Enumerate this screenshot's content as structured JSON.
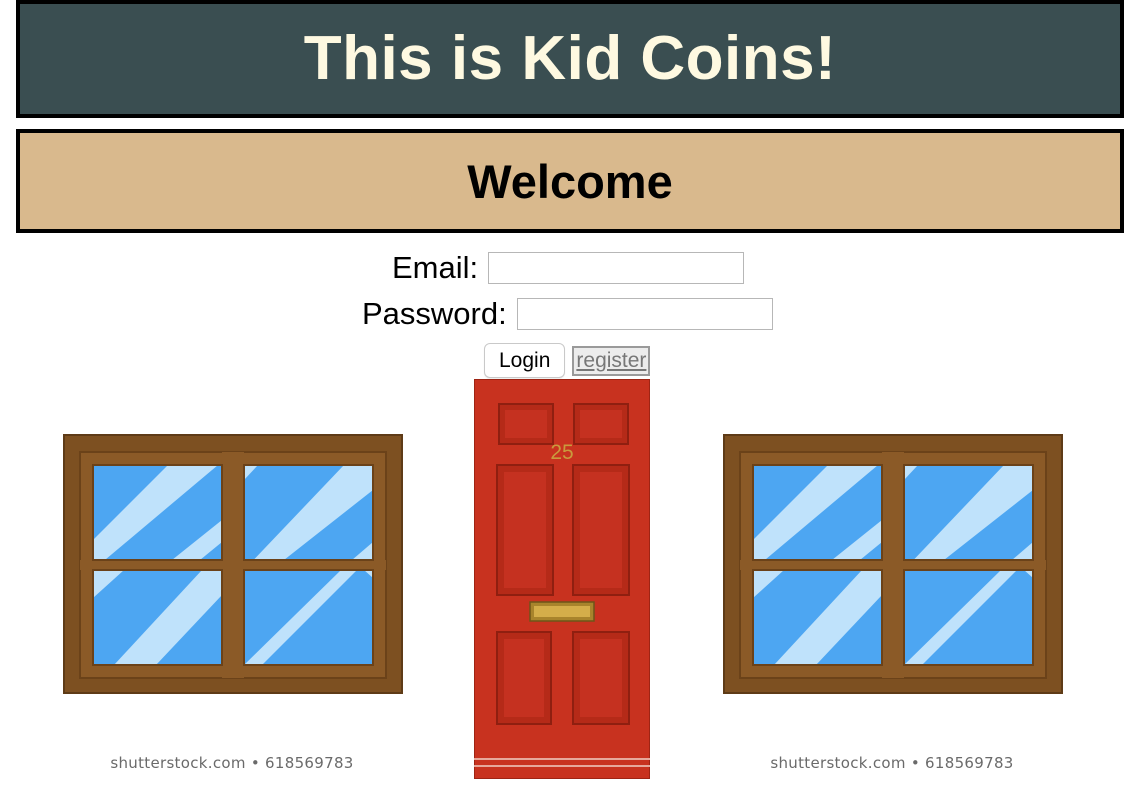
{
  "header": {
    "title": "This is Kid Coins!"
  },
  "welcome": {
    "heading": "Welcome"
  },
  "login_form": {
    "email_label": "Email:",
    "email_value": "",
    "password_label": "Password:",
    "password_value": "",
    "login_button": "Login",
    "register_link": "register"
  },
  "scene": {
    "door_number": "25",
    "left_window_watermark": "shutterstock.com • 618569783",
    "right_window_watermark": "shutterstock.com • 618569783"
  },
  "colors": {
    "header_bg": "#3a4e51",
    "header_text": "#fef9e1",
    "welcome_bg": "#d9b98d",
    "door_red": "#c8321f",
    "window_frame": "#7d5021",
    "glass_blue": "#4da6f2",
    "glass_highlight": "#bfe2fb"
  }
}
